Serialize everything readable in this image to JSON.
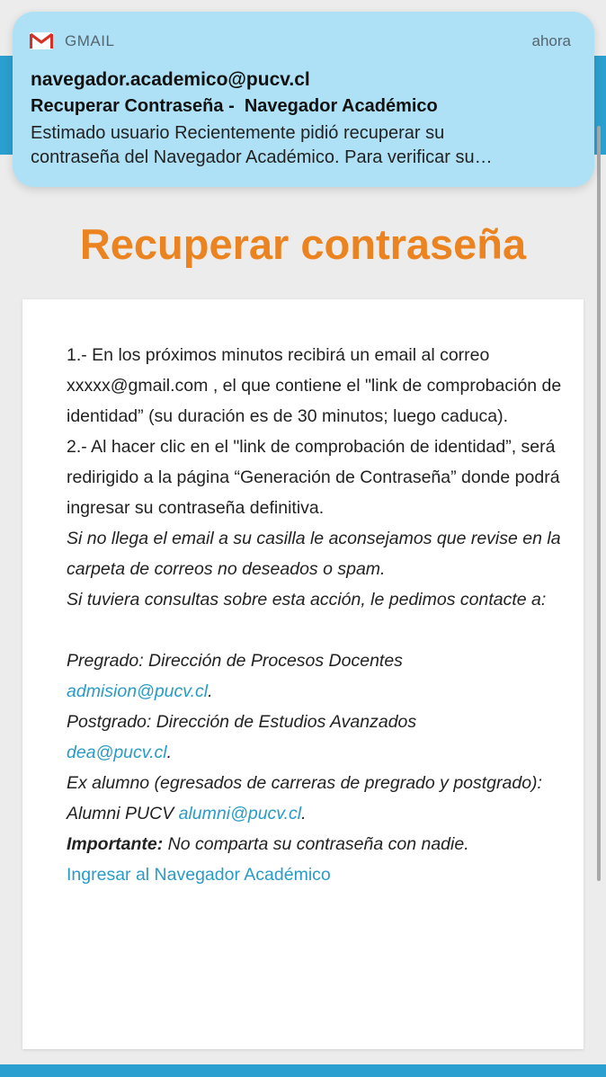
{
  "notification": {
    "app_name": "GMAIL",
    "time": "ahora",
    "sender": "navegador.academico@pucv.cl",
    "subject": "Recuperar Contraseña -  Navegador Académico",
    "preview_line1": "Estimado usuario Recientemente pidió recuperar su",
    "preview_line2": "contraseña del Navegador Académico. Para verificar su…"
  },
  "page": {
    "title": "Recuperar contraseña"
  },
  "content": {
    "step1": "1.- En los próximos minutos recibirá un email al correo xxxxx@gmail.com , el que contiene el \"link de comprobación de identidad” (su duración es de 30 minutos; luego caduca).",
    "step2": "2.- Al hacer clic en el \"link de comprobación de identidad”, será redirigido a la página “Generación de Contraseña” donde podrá ingresar su contraseña definitiva.",
    "spam_note": "Si no llega el email a su casilla le aconsejamos que revise en la carpeta de correos no deseados o spam.",
    "contact_intro": "Si tuviera consultas sobre esta acción, le pedimos contacte a:",
    "pregrado_label": "Pregrado: Dirección de Procesos Docentes",
    "pregrado_email": "admision@pucv.cl",
    "postgrado_label": "Postgrado: Dirección de Estudios Avanzados",
    "postgrado_email": "dea@pucv.cl",
    "alumni_label": "Ex alumno (egresados de carreras de pregrado y postgrado): Alumni PUCV",
    "alumni_email": "alumni@pucv.cl",
    "important_label": "Importante:",
    "important_text": "No comparta su contraseña con nadie.",
    "period": ".",
    "login_link": "Ingresar al Navegador Académico"
  },
  "colors": {
    "title_orange": "#eb8420",
    "link_blue": "#2a9bc6",
    "header_blue": "#2b9fcf",
    "notification_bg": "#aee1f6"
  },
  "icons": {
    "app_icon": "gmail-icon"
  }
}
